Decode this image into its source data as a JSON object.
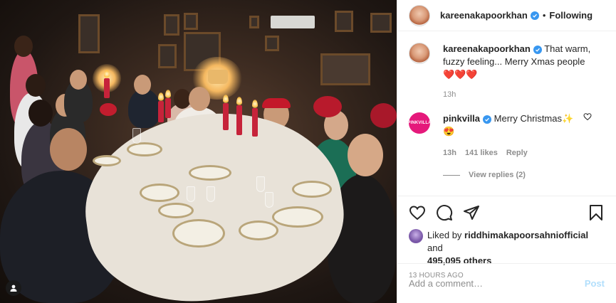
{
  "post": {
    "image_alt": "Group dinner photo at a decorated table"
  },
  "header": {
    "username": "kareenakapoorkhan",
    "separator": "•",
    "follow_status": "Following"
  },
  "caption": {
    "username": "kareenakapoorkhan",
    "text": "That warm, fuzzy feeling... Merry Xmas people",
    "emojis": "❤️❤️❤️",
    "time": "13h"
  },
  "comments": [
    {
      "username": "pinkvilla",
      "avatar_text": "PINKVILLA",
      "text": "Merry Christmas",
      "emoji_inline": "✨",
      "emoji_line": "😍",
      "time": "13h",
      "likes": "141 likes",
      "reply_label": "Reply",
      "view_replies": "View replies (2)"
    }
  ],
  "likes": {
    "prefix": "Liked by",
    "user": "riddhimakapoorsahniofficial",
    "and": "and",
    "others": "495,095 others"
  },
  "date": "13 HOURS AGO",
  "add_comment": {
    "placeholder": "Add a comment…",
    "post_label": "Post"
  },
  "colors": {
    "verified": "#3897f0",
    "heart_red": "#ed4956",
    "post_disabled": "#b2dffc",
    "pinkvilla": "#e5197b"
  },
  "icons": [
    "verified-badge-icon",
    "heart-icon",
    "comment-icon",
    "share-icon",
    "bookmark-icon",
    "user-tag-icon"
  ]
}
